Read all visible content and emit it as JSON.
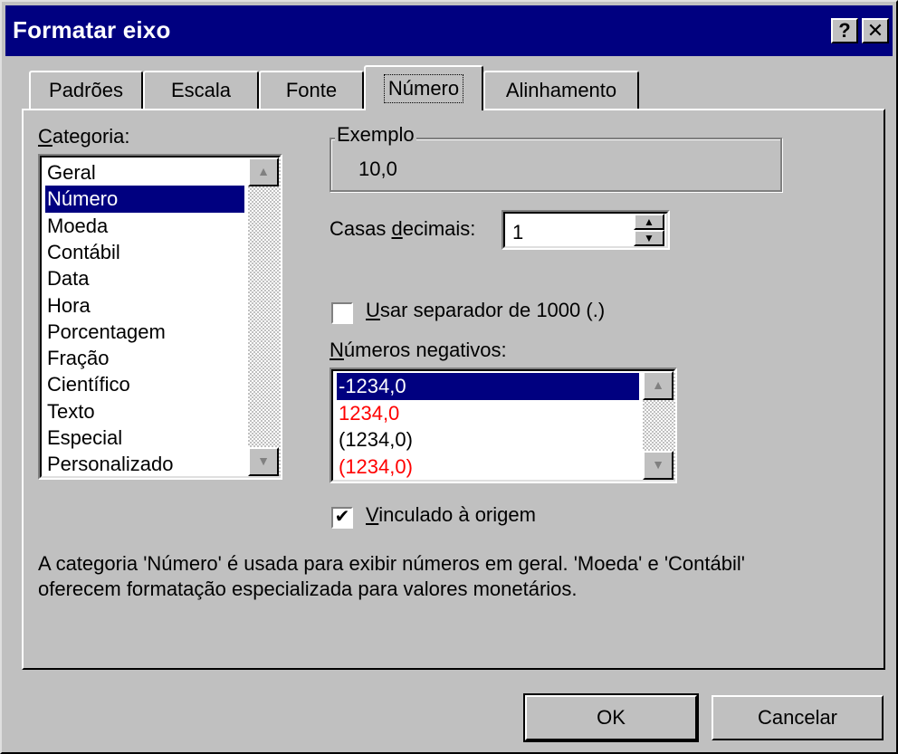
{
  "window": {
    "title": "Formatar eixo",
    "help_label": "?",
    "close_label": "✕"
  },
  "tabs": [
    {
      "label": "Padrões"
    },
    {
      "label": "Escala"
    },
    {
      "label": "Fonte"
    },
    {
      "label": "Número",
      "active": true
    },
    {
      "label": "Alinhamento"
    }
  ],
  "category": {
    "label": "Categoria:",
    "items": [
      "Geral",
      "Número",
      "Moeda",
      "Contábil",
      "Data",
      "Hora",
      "Porcentagem",
      "Fração",
      "Científico",
      "Texto",
      "Especial",
      "Personalizado"
    ],
    "selected": "Número"
  },
  "example": {
    "label": "Exemplo",
    "value": "10,0"
  },
  "decimals": {
    "label": "Casas decimais:",
    "value": "1"
  },
  "thousands": {
    "label": "Usar separador de 1000 (.)",
    "checked": false
  },
  "negatives": {
    "label": "Números negativos:",
    "items": [
      {
        "text": "-1234,0",
        "color": "#ffffff",
        "selected": true
      },
      {
        "text": "1234,0",
        "color": "#ff0000"
      },
      {
        "text": "(1234,0)",
        "color": "#000000"
      },
      {
        "text": "(1234,0)",
        "color": "#ff0000"
      }
    ]
  },
  "linked": {
    "label": "Vinculado à origem",
    "checked": true
  },
  "description": {
    "line1": "A categoria 'Número' é usada para exibir números em geral. 'Moeda' e 'Contábil'",
    "line2": "oferecem formatação especializada para valores monetários."
  },
  "buttons": {
    "ok": "OK",
    "cancel": "Cancelar"
  },
  "colors": {
    "titlebar": "#000080",
    "face": "#c0c0c0",
    "selection": "#000080",
    "negative_red": "#ff0000"
  }
}
